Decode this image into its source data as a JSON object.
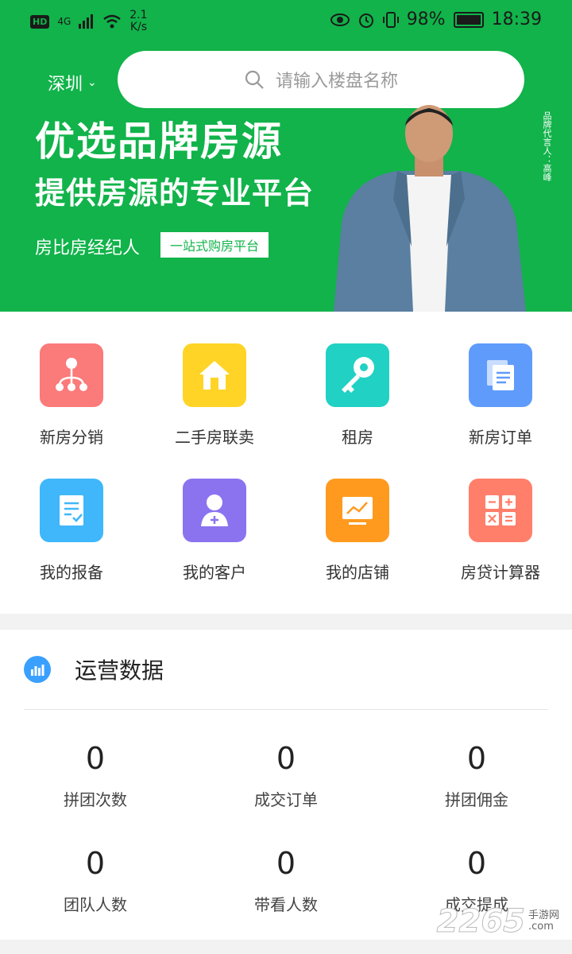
{
  "status_bar": {
    "hd": "HD",
    "network": "4G",
    "speed": "2.1",
    "speed_unit": "K/s",
    "battery": "98%",
    "time": "18:39"
  },
  "header": {
    "city": "深圳",
    "search_placeholder": "请输入楼盘名称"
  },
  "banner": {
    "headline1": "优选品牌房源",
    "headline2": "提供房源的专业平台",
    "agent": "房比房经纪人",
    "tagline": "一站式购房平台",
    "endorsement": "品牌代言人：高峰"
  },
  "menu": [
    {
      "label": "新房分销",
      "icon": "org-tree-icon",
      "color": "#fb7a7a"
    },
    {
      "label": "二手房联卖",
      "icon": "house-icon",
      "color": "#ffd426"
    },
    {
      "label": "租房",
      "icon": "key-icon",
      "color": "#21d1c3"
    },
    {
      "label": "新房订单",
      "icon": "documents-icon",
      "color": "#5f9bfb"
    },
    {
      "label": "我的报备",
      "icon": "checklist-icon",
      "color": "#3fb7fa"
    },
    {
      "label": "我的客户",
      "icon": "customer-icon",
      "color": "#8b73f0"
    },
    {
      "label": "我的店铺",
      "icon": "chart-board-icon",
      "color": "#ff9a1f"
    },
    {
      "label": "房贷计算器",
      "icon": "calculator-icon",
      "color": "#ff7f6b"
    }
  ],
  "operations": {
    "title": "运营数据",
    "stats": [
      {
        "value": "0",
        "label": "拼团次数"
      },
      {
        "value": "0",
        "label": "成交订单"
      },
      {
        "value": "0",
        "label": "拼团佣金"
      },
      {
        "value": "0",
        "label": "团队人数"
      },
      {
        "value": "0",
        "label": "带看人数"
      },
      {
        "value": "0",
        "label": "成交提成"
      }
    ]
  },
  "watermark": {
    "number": "2265",
    "suffix": "手游网",
    "domain": ".com"
  }
}
